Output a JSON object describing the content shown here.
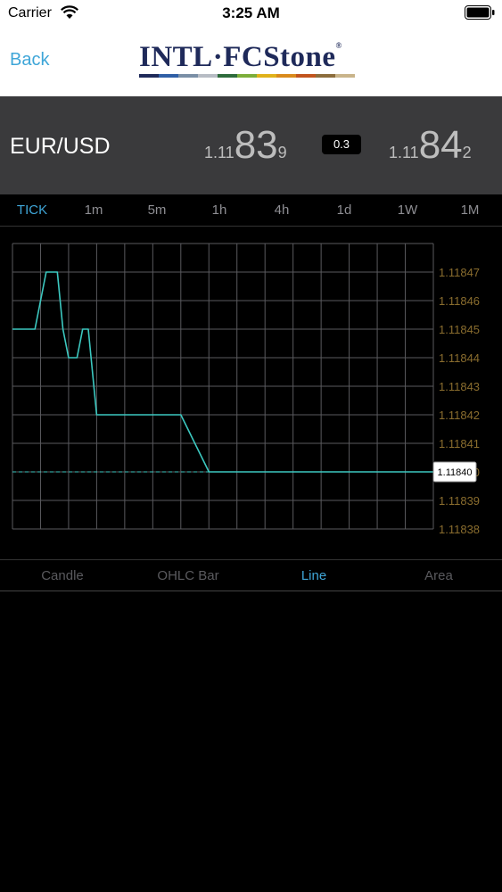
{
  "status_bar": {
    "carrier": "Carrier",
    "time": "3:25 AM"
  },
  "nav": {
    "back_label": "Back",
    "logo_text": "INTL·FCStone",
    "logo_reg": "®"
  },
  "quote": {
    "pair": "EUR/USD",
    "bid": {
      "prefix": "1.11",
      "big": "83",
      "sup": "9"
    },
    "spread": "0.3",
    "ask": {
      "prefix": "1.11",
      "big": "84",
      "sup": "2"
    }
  },
  "timeframes": [
    {
      "label": "TICK",
      "active": true
    },
    {
      "label": "1m",
      "active": false
    },
    {
      "label": "5m",
      "active": false
    },
    {
      "label": "1h",
      "active": false
    },
    {
      "label": "4h",
      "active": false
    },
    {
      "label": "1d",
      "active": false
    },
    {
      "label": "1W",
      "active": false
    },
    {
      "label": "1M",
      "active": false
    }
  ],
  "chart_types": [
    {
      "label": "Candle",
      "active": false
    },
    {
      "label": "OHLC Bar",
      "active": false
    },
    {
      "label": "Line",
      "active": true
    },
    {
      "label": "Area",
      "active": false
    }
  ],
  "colors": {
    "accent": "#3fa6d8",
    "line": "#3cc8c0",
    "axis_label": "#8a6d2e",
    "grid": "#5a5a5e"
  },
  "chart_data": {
    "type": "line",
    "y_ticks": [
      "1.11847",
      "1.11846",
      "1.11845",
      "1.11844",
      "1.11843",
      "1.11842",
      "1.11841",
      "1.11840",
      "1.11839",
      "1.11838"
    ],
    "ylim": [
      1.11838,
      1.11847
    ],
    "current_value": "1.11840",
    "grid": true,
    "x": [
      0,
      0.8,
      1.2,
      1.6,
      1.8,
      2.0,
      2.3,
      2.5,
      2.7,
      3.0,
      3.5,
      4.0,
      5.0,
      6.0,
      7.0,
      15.0
    ],
    "values": [
      1.11845,
      1.11845,
      1.11847,
      1.11847,
      1.11845,
      1.11844,
      1.11844,
      1.11845,
      1.11845,
      1.11842,
      1.11842,
      1.11842,
      1.11842,
      1.11842,
      1.1184,
      1.1184
    ]
  }
}
